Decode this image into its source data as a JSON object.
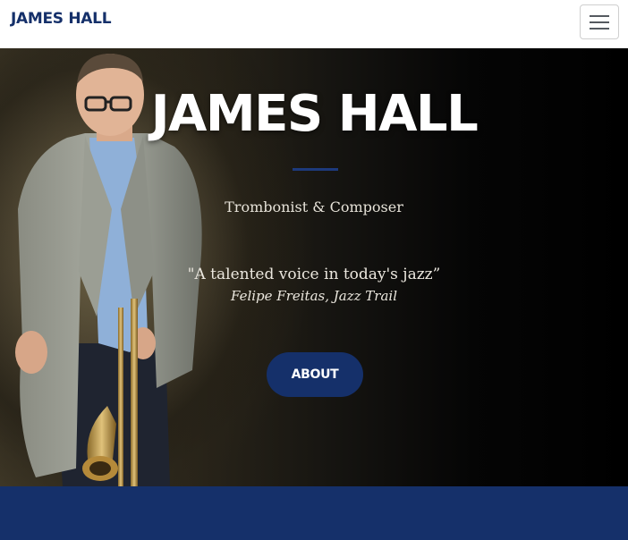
{
  "navbar": {
    "brand": "JAMES HALL",
    "menu_icon": "hamburger-menu-icon"
  },
  "hero": {
    "title": "JAMES HALL",
    "subtitle": "Trombonist & Composer",
    "quote": "\"A talented voice in today's jazz”",
    "attribution": "Felipe Freitas, Jazz Trail",
    "button_label": "ABOUT"
  },
  "colors": {
    "brand": "#15306a",
    "hero_background": "#000000",
    "text_light": "#ffffff"
  }
}
